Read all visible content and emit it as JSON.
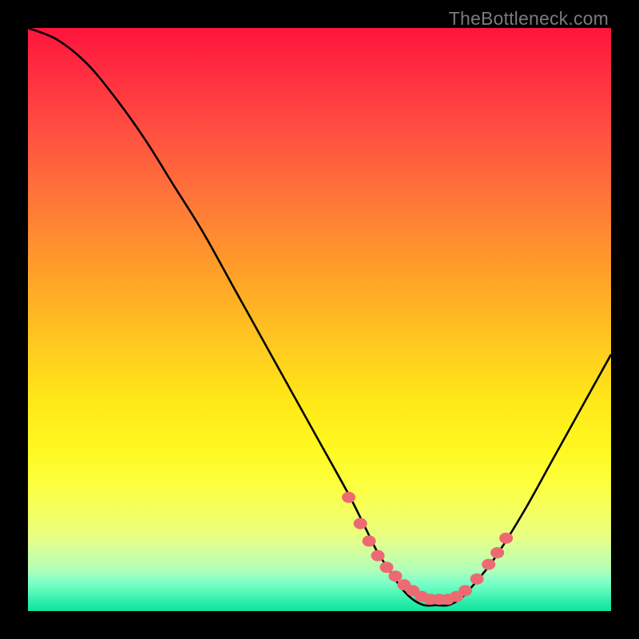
{
  "watermark": "TheBottleneck.com",
  "chart_data": {
    "type": "line",
    "title": "",
    "xlabel": "",
    "ylabel": "",
    "xlim": [
      0,
      100
    ],
    "ylim": [
      0,
      100
    ],
    "curve": {
      "x": [
        0,
        5,
        10,
        15,
        20,
        25,
        30,
        35,
        40,
        45,
        50,
        55,
        58,
        60,
        62,
        64,
        66,
        68,
        70,
        72,
        74,
        76,
        80,
        85,
        90,
        95,
        100
      ],
      "y": [
        100,
        98,
        94,
        88,
        81,
        73,
        65,
        56,
        47,
        38,
        29,
        20,
        14,
        10,
        7,
        4,
        2,
        1,
        1,
        1,
        2,
        4,
        9,
        17,
        26,
        35,
        44
      ]
    },
    "markers": {
      "x": [
        55.0,
        57.0,
        58.5,
        60.0,
        61.5,
        63.0,
        64.5,
        66.0,
        67.5,
        69.0,
        70.5,
        72.0,
        73.5,
        75.0,
        77.0,
        79.0,
        80.5,
        82.0
      ],
      "y": [
        19.5,
        15.0,
        12.0,
        9.5,
        7.5,
        6.0,
        4.5,
        3.5,
        2.5,
        2.0,
        2.0,
        2.0,
        2.5,
        3.5,
        5.5,
        8.0,
        10.0,
        12.5
      ]
    },
    "marker_color": "#ed6a72",
    "curve_color": "#000000",
    "gradient_stops": [
      {
        "pos": 0,
        "color": "#ff143c"
      },
      {
        "pos": 100,
        "color": "#14e4a0"
      }
    ]
  }
}
